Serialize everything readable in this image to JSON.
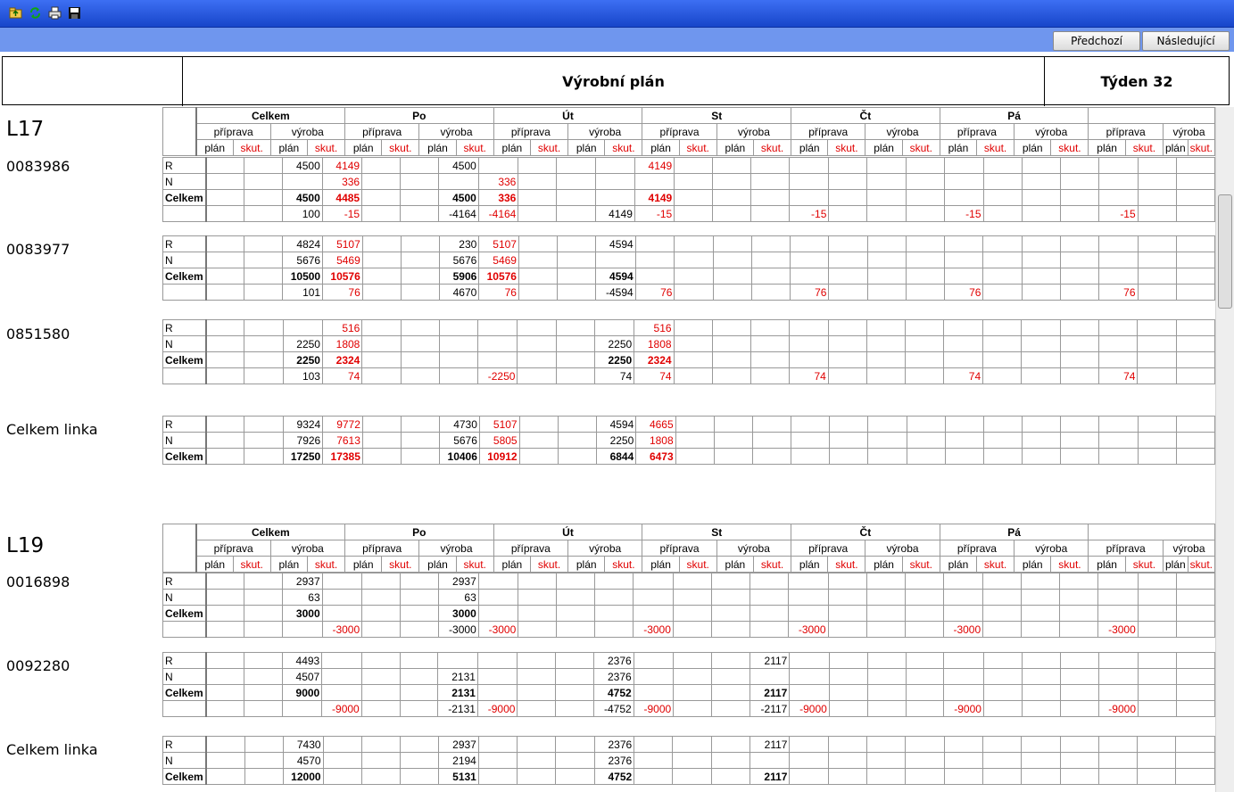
{
  "toolbar": {
    "icons": [
      "folder-up-icon",
      "refresh-icon",
      "print-icon",
      "save-icon"
    ]
  },
  "nav": {
    "prev_label": "Předchozí",
    "next_label": "Následující"
  },
  "header": {
    "left": "",
    "title": "Výrobní plán",
    "week": "Týden 32"
  },
  "grid_headers": {
    "days": [
      "Celkem",
      "Po",
      "Út",
      "St",
      "Čt",
      "Pá",
      ""
    ],
    "sub": [
      "příprava",
      "výroba"
    ],
    "cols": [
      "plán",
      "skut."
    ]
  },
  "lines": [
    {
      "name": "L17",
      "items": [
        {
          "code": "0083986",
          "rows": [
            {
              "label": "R",
              "cells": [
                "",
                "",
                "4500",
                "4149",
                "",
                "",
                "4500",
                "",
                "",
                "",
                "",
                "4149",
                "",
                "",
                "",
                "",
                "",
                "",
                "",
                "",
                "",
                "",
                "",
                "",
                "",
                ""
              ]
            },
            {
              "label": "N",
              "cells": [
                "",
                "",
                "",
                "336",
                "",
                "",
                "",
                "336",
                "",
                "",
                "",
                "",
                "",
                "",
                "",
                "",
                "",
                "",
                "",
                "",
                "",
                "",
                "",
                "",
                "",
                ""
              ]
            },
            {
              "label": "Celkem",
              "cells": [
                "",
                "",
                "4500",
                "4485",
                "",
                "",
                "4500",
                "336",
                "",
                "",
                "",
                "4149",
                "",
                "",
                "",
                "",
                "",
                "",
                "",
                "",
                "",
                "",
                "",
                "",
                "",
                ""
              ]
            },
            {
              "label": "",
              "cells": [
                "",
                "",
                "100",
                "-15",
                "",
                "",
                "-4164",
                "-4164",
                "",
                "",
                "4149",
                "-15",
                "",
                "",
                "",
                "-15",
                "",
                "",
                "",
                "-15",
                "",
                "",
                "",
                "-15",
                "",
                ""
              ]
            }
          ]
        },
        {
          "code": "0083977",
          "rows": [
            {
              "label": "R",
              "cells": [
                "",
                "",
                "4824",
                "5107",
                "",
                "",
                "230",
                "5107",
                "",
                "",
                "4594",
                "",
                "",
                "",
                "",
                "",
                "",
                "",
                "",
                "",
                "",
                "",
                "",
                "",
                "",
                ""
              ]
            },
            {
              "label": "N",
              "cells": [
                "",
                "",
                "5676",
                "5469",
                "",
                "",
                "5676",
                "5469",
                "",
                "",
                "",
                "",
                "",
                "",
                "",
                "",
                "",
                "",
                "",
                "",
                "",
                "",
                "",
                "",
                "",
                ""
              ]
            },
            {
              "label": "Celkem",
              "cells": [
                "",
                "",
                "10500",
                "10576",
                "",
                "",
                "5906",
                "10576",
                "",
                "",
                "4594",
                "",
                "",
                "",
                "",
                "",
                "",
                "",
                "",
                "",
                "",
                "",
                "",
                "",
                "",
                ""
              ]
            },
            {
              "label": "",
              "cells": [
                "",
                "",
                "101",
                "76",
                "",
                "",
                "4670",
                "76",
                "",
                "",
                "-4594",
                "76",
                "",
                "",
                "",
                "76",
                "",
                "",
                "",
                "76",
                "",
                "",
                "",
                "76",
                "",
                ""
              ]
            }
          ]
        },
        {
          "code": "0851580",
          "rows": [
            {
              "label": "R",
              "cells": [
                "",
                "",
                "",
                "516",
                "",
                "",
                "",
                "",
                "",
                "",
                "",
                "516",
                "",
                "",
                "",
                "",
                "",
                "",
                "",
                "",
                "",
                "",
                "",
                "",
                "",
                ""
              ]
            },
            {
              "label": "N",
              "cells": [
                "",
                "",
                "2250",
                "1808",
                "",
                "",
                "",
                "",
                "",
                "",
                "2250",
                "1808",
                "",
                "",
                "",
                "",
                "",
                "",
                "",
                "",
                "",
                "",
                "",
                "",
                "",
                ""
              ]
            },
            {
              "label": "Celkem",
              "cells": [
                "",
                "",
                "2250",
                "2324",
                "",
                "",
                "",
                "",
                "",
                "",
                "2250",
                "2324",
                "",
                "",
                "",
                "",
                "",
                "",
                "",
                "",
                "",
                "",
                "",
                "",
                "",
                ""
              ]
            },
            {
              "label": "",
              "cells": [
                "",
                "",
                "103",
                "74",
                "",
                "",
                "",
                "-2250",
                "",
                "",
                "74",
                "74",
                "",
                "",
                "",
                "74",
                "",
                "",
                "",
                "74",
                "",
                "",
                "",
                "74",
                "",
                ""
              ]
            }
          ]
        }
      ],
      "total": {
        "code": "Celkem linka",
        "rows": [
          {
            "label": "R",
            "cells": [
              "",
              "",
              "9324",
              "9772",
              "",
              "",
              "4730",
              "5107",
              "",
              "",
              "4594",
              "4665",
              "",
              "",
              "",
              "",
              "",
              "",
              "",
              "",
              "",
              "",
              "",
              "",
              "",
              ""
            ]
          },
          {
            "label": "N",
            "cells": [
              "",
              "",
              "7926",
              "7613",
              "",
              "",
              "5676",
              "5805",
              "",
              "",
              "2250",
              "1808",
              "",
              "",
              "",
              "",
              "",
              "",
              "",
              "",
              "",
              "",
              "",
              "",
              "",
              ""
            ]
          },
          {
            "label": "Celkem",
            "cells": [
              "",
              "",
              "17250",
              "17385",
              "",
              "",
              "10406",
              "10912",
              "",
              "",
              "6844",
              "6473",
              "",
              "",
              "",
              "",
              "",
              "",
              "",
              "",
              "",
              "",
              "",
              "",
              "",
              ""
            ]
          }
        ]
      }
    },
    {
      "name": "L19",
      "items": [
        {
          "code": "0016898",
          "rows": [
            {
              "label": "R",
              "cells": [
                "",
                "",
                "2937",
                "",
                "",
                "",
                "2937",
                "",
                "",
                "",
                "",
                "",
                "",
                "",
                "",
                "",
                "",
                "",
                "",
                "",
                "",
                "",
                "",
                "",
                "",
                ""
              ]
            },
            {
              "label": "N",
              "cells": [
                "",
                "",
                "63",
                "",
                "",
                "",
                "63",
                "",
                "",
                "",
                "",
                "",
                "",
                "",
                "",
                "",
                "",
                "",
                "",
                "",
                "",
                "",
                "",
                "",
                "",
                ""
              ]
            },
            {
              "label": "Celkem",
              "cells": [
                "",
                "",
                "3000",
                "",
                "",
                "",
                "3000",
                "",
                "",
                "",
                "",
                "",
                "",
                "",
                "",
                "",
                "",
                "",
                "",
                "",
                "",
                "",
                "",
                "",
                "",
                ""
              ]
            },
            {
              "label": "",
              "cells": [
                "",
                "",
                "",
                "-3000",
                "",
                "",
                "-3000",
                "-3000",
                "",
                "",
                "",
                "-3000",
                "",
                "",
                "",
                "-3000",
                "",
                "",
                "",
                "-3000",
                "",
                "",
                "",
                "-3000",
                "",
                ""
              ]
            }
          ]
        },
        {
          "code": "0092280",
          "rows": [
            {
              "label": "R",
              "cells": [
                "",
                "",
                "4493",
                "",
                "",
                "",
                "",
                "",
                "",
                "",
                "2376",
                "",
                "",
                "",
                "2117",
                "",
                "",
                "",
                "",
                "",
                "",
                "",
                "",
                "",
                "",
                ""
              ]
            },
            {
              "label": "N",
              "cells": [
                "",
                "",
                "4507",
                "",
                "",
                "",
                "2131",
                "",
                "",
                "",
                "2376",
                "",
                "",
                "",
                "",
                "",
                "",
                "",
                "",
                "",
                "",
                "",
                "",
                "",
                "",
                ""
              ]
            },
            {
              "label": "Celkem",
              "cells": [
                "",
                "",
                "9000",
                "",
                "",
                "",
                "2131",
                "",
                "",
                "",
                "4752",
                "",
                "",
                "",
                "2117",
                "",
                "",
                "",
                "",
                "",
                "",
                "",
                "",
                "",
                "",
                ""
              ]
            },
            {
              "label": "",
              "cells": [
                "",
                "",
                "",
                "-9000",
                "",
                "",
                "-2131",
                "-9000",
                "",
                "",
                "-4752",
                "-9000",
                "",
                "",
                "-2117",
                "-9000",
                "",
                "",
                "",
                "-9000",
                "",
                "",
                "",
                "-9000",
                "",
                ""
              ]
            }
          ]
        }
      ],
      "total": {
        "code": "Celkem linka",
        "rows": [
          {
            "label": "R",
            "cells": [
              "",
              "",
              "7430",
              "",
              "",
              "",
              "2937",
              "",
              "",
              "",
              "2376",
              "",
              "",
              "",
              "2117",
              "",
              "",
              "",
              "",
              "",
              "",
              "",
              "",
              "",
              "",
              ""
            ]
          },
          {
            "label": "N",
            "cells": [
              "",
              "",
              "4570",
              "",
              "",
              "",
              "2194",
              "",
              "",
              "",
              "2376",
              "",
              "",
              "",
              "",
              "",
              "",
              "",
              "",
              "",
              "",
              "",
              "",
              "",
              "",
              ""
            ]
          },
          {
            "label": "Celkem",
            "cells": [
              "",
              "",
              "12000",
              "",
              "",
              "",
              "5131",
              "",
              "",
              "",
              "4752",
              "",
              "",
              "",
              "2117",
              "",
              "",
              "",
              "",
              "",
              "",
              "",
              "",
              "",
              "",
              ""
            ]
          }
        ]
      }
    }
  ]
}
